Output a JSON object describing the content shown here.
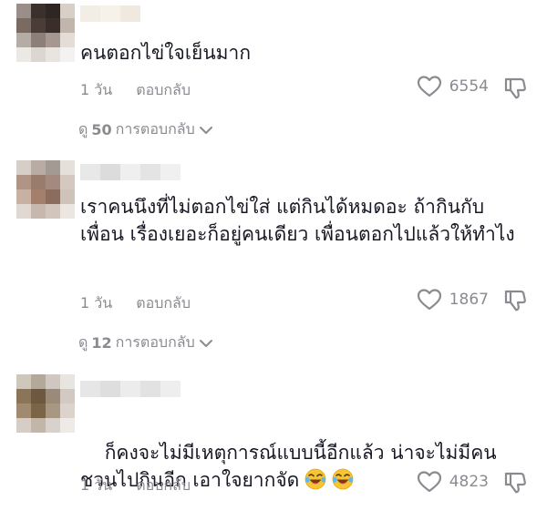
{
  "comments": [
    {
      "text": "คนตอกไข่ใจเย็นมาก",
      "time": "1 วัน",
      "reply_label": "ตอบกลับ",
      "likes": "6554",
      "view_replies": {
        "prefix": "ดู",
        "count": "50",
        "suffix": "การตอบกลับ"
      },
      "avatar_colors": [
        "#9a8f88",
        "#3a302c",
        "#2e2622",
        "#d8cfc6",
        "#7a6a60",
        "#4a3c36",
        "#3a2e2a",
        "#c2b6ac",
        "#b6aca6",
        "#8c7e78",
        "#a69890",
        "#e4dcd6",
        "#ece8e4",
        "#dcd6d2",
        "#e8e4e0",
        "#f4f2f0"
      ],
      "name_colors": [
        "#f2eee6",
        "#f6f2ea",
        "#efe9df"
      ]
    },
    {
      "text": "เราคนนึงที่ไม่ตอกไข่ใส่ แต่กินได้หมดอะ ถ้ากินกับเพื่อน เรื่องเยอะก็อยู่คนเดียว เพื่อนตอกไปแล้วให้ทำไง",
      "time": "1 วัน",
      "reply_label": "ตอบกลับ",
      "likes": "1867",
      "view_replies": {
        "prefix": "ดู",
        "count": "12",
        "suffix": "การตอบกลับ"
      },
      "avatar_colors": [
        "#d6cfc8",
        "#b8aca4",
        "#a49a94",
        "#e6e0da",
        "#b09486",
        "#9a7c6c",
        "#a48a7e",
        "#d4c8c0",
        "#c8b0a2",
        "#a4806c",
        "#8c6c5c",
        "#cfc2b8",
        "#e0d8d2",
        "#c6b8ae",
        "#d2c6bc",
        "#ebe6e2"
      ],
      "name_colors": [
        "#e8e8e8",
        "#dcdcdc",
        "#efefef",
        "#e4e4e4",
        "#f0f0f0"
      ]
    },
    {
      "text": "ก็คงจะไม่มีเหตุการณ์แบบนี้อีกแล้ว น่าจะไม่มีคนชวนไปกินอีก เอาใจยากจัด",
      "emoji": [
        "😂",
        "😂"
      ],
      "time": "1 วัน",
      "reply_label": "ตอบกลับ",
      "likes": "4823",
      "avatar_colors": [
        "#cfc6bc",
        "#b4a898",
        "#d0c8c0",
        "#e8e4e0",
        "#8c7458",
        "#6e5840",
        "#9a8a78",
        "#d2cac2",
        "#a08a70",
        "#7c6448",
        "#a89882",
        "#dcd4cc",
        "#d6cec6",
        "#c2b6a8",
        "#d8d2cc",
        "#eeeae6"
      ],
      "name_colors": [
        "#e6e6e6",
        "#dedede",
        "#ececec",
        "#e2e2e2",
        "#eeeeee"
      ]
    }
  ],
  "colors": {
    "text_primary": "#161823",
    "text_secondary": "#8a8b91",
    "background": "#ffffff"
  },
  "icons": {
    "like": "heart-outline-icon",
    "dislike": "thumbs-down-outline-icon",
    "expand": "chevron-down-icon"
  }
}
